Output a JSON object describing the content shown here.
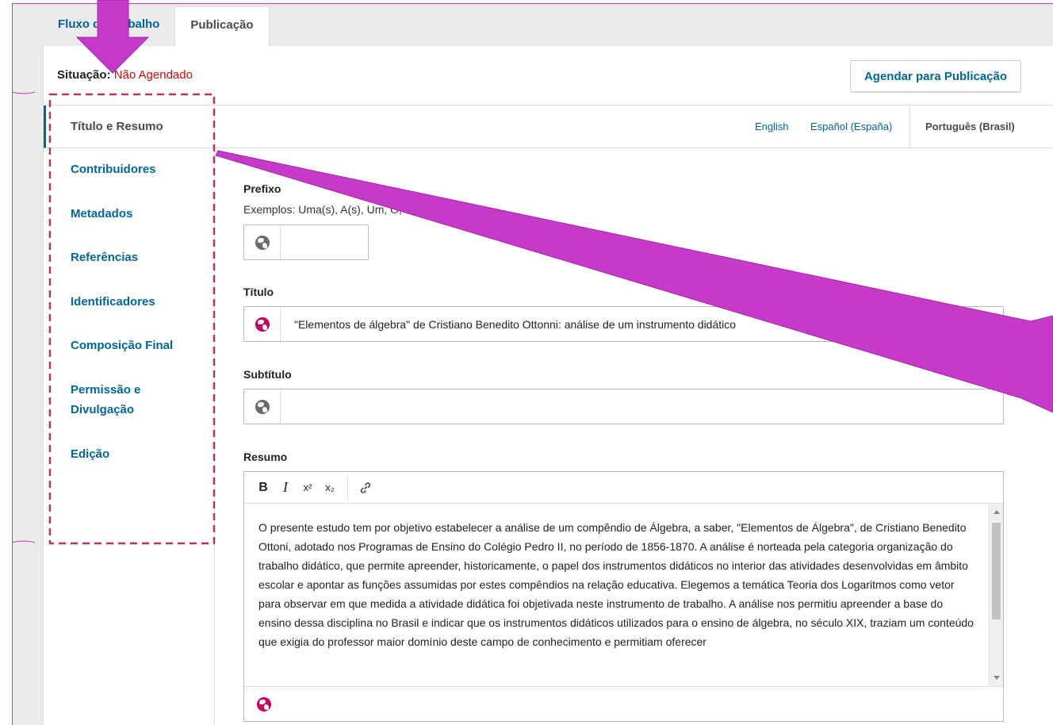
{
  "tabs": [
    {
      "label": "Fluxo de Trabalho"
    },
    {
      "label": "Publicação"
    }
  ],
  "status": {
    "label": "Situação:",
    "value": "Não Agendado"
  },
  "schedule_button": "Agendar para Publicação",
  "side_nav": [
    {
      "label": "Título e Resumo"
    },
    {
      "label": "Contribuidores"
    },
    {
      "label": "Metadados"
    },
    {
      "label": "Referências"
    },
    {
      "label": "Identificadores"
    },
    {
      "label": "Composição Final"
    },
    {
      "label": "Permissão e Divulgação"
    },
    {
      "label": "Edição"
    }
  ],
  "languages": [
    {
      "label": "English"
    },
    {
      "label": "Español (España)"
    },
    {
      "label": "Português (Brasil)"
    }
  ],
  "form": {
    "prefix_label": "Prefixo",
    "prefix_description": "Exemplos: Uma(s), A(s), Um, O, O(s)",
    "prefix_value": "",
    "title_label": "Título",
    "title_value": "\"Elementos de álgebra\" de Cristiano Benedito Ottonni: análise de um instrumento didático",
    "subtitle_label": "Subtítulo",
    "subtitle_value": "",
    "abstract_label": "Resumo",
    "abstract_text": "O presente estudo tem por objetivo estabelecer a análise de um compêndio de Álgebra, a saber, \"Elementos de Álgebra\", de Cristiano Benedito Ottoni, adotado nos Programas de Ensino do Colégio Pedro II, no período de 1856-1870. A análise é norteada pela categoria organização do trabalho didático, que permite apreender, historicamente, o papel dos instrumentos didáticos no interior das atividades desenvolvidas em âmbito escolar e apontar as funções assumidas por estes compêndios na relação educativa. Elegemos a temática Teoria dos Logaritmos como vetor para observar em que medida a atividade didática foi objetivada neste instrumento de trabalho. A análise nos permitiu apreender a base do ensino dessa disciplina no Brasil e indicar que os instrumentos didáticos utilizados para o ensino de álgebra, no século XIX, traziam um conteúdo que exigia do professor maior domínio deste campo de conhecimento e permitiam oferecer"
  },
  "toolbar": {
    "bold": "B",
    "italic": "I",
    "superscript": "x²",
    "subscript": "x₂"
  },
  "colors": {
    "link": "#006798",
    "status_red": "#d00a0a",
    "annotation_magenta": "#c53ac9",
    "dashed_box": "#b5336b",
    "globe_pink": "#c5005d"
  }
}
